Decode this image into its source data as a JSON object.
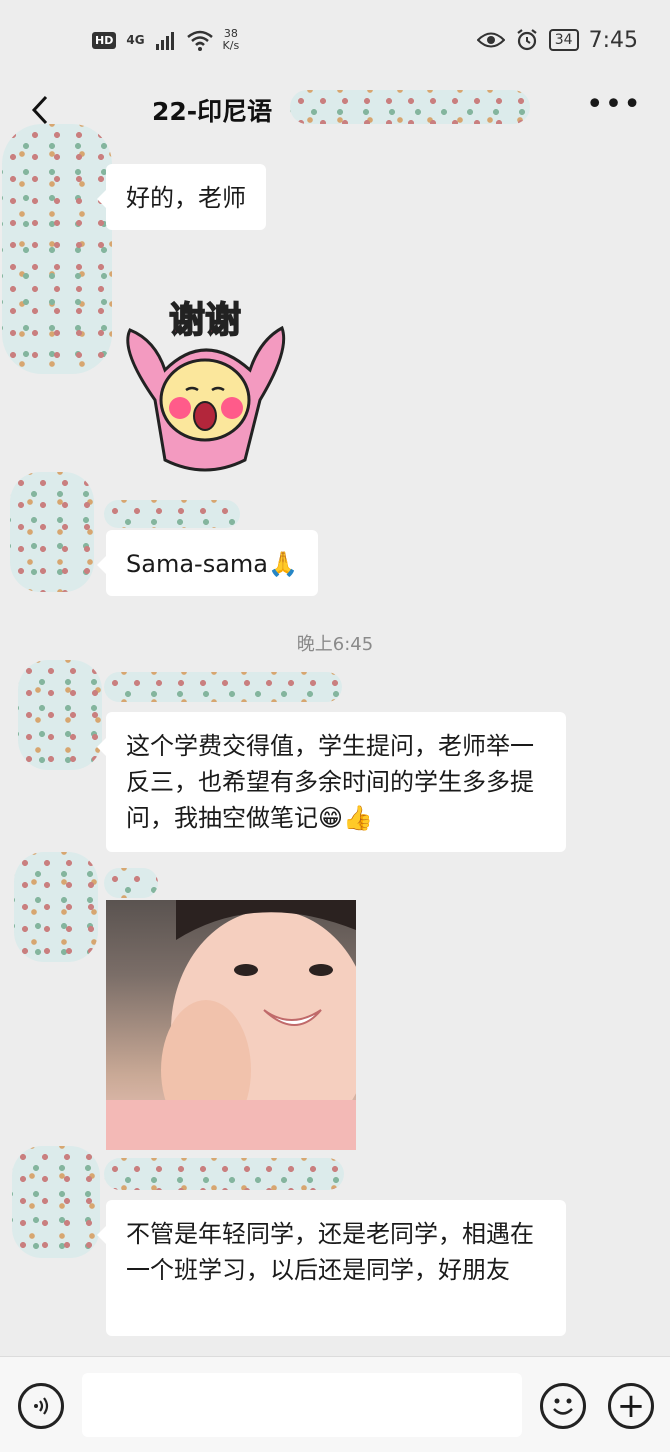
{
  "status_bar": {
    "hd": "HD",
    "network": "4G",
    "speed_value": "38",
    "speed_unit": "K/s",
    "battery": "34",
    "time": "7:45"
  },
  "header": {
    "title": "22-印尼语"
  },
  "messages": [
    {
      "type": "text",
      "text": "好的，老师"
    },
    {
      "type": "sticker",
      "text": "谢谢"
    },
    {
      "type": "text",
      "text": "Sama-sama",
      "emoji": "🙏"
    },
    {
      "type": "time",
      "text": "晚上6:45"
    },
    {
      "type": "text",
      "text": "这个学费交得值，学生提问，老师举一反三，也希望有多余时间的学生多多提问，我抽空做笔记",
      "emoji": "😁👍"
    },
    {
      "type": "image"
    },
    {
      "type": "text",
      "text": "不管是年轻同学，还是老同学，相遇在一个班学习，以后还是同学，好朋友"
    }
  ],
  "input_bar": {
    "placeholder": ""
  },
  "colors": {
    "background": "#ededed",
    "bubble": "#ffffff",
    "sticker_pink": "#f39ac0",
    "sticker_face": "#fbe79c"
  }
}
